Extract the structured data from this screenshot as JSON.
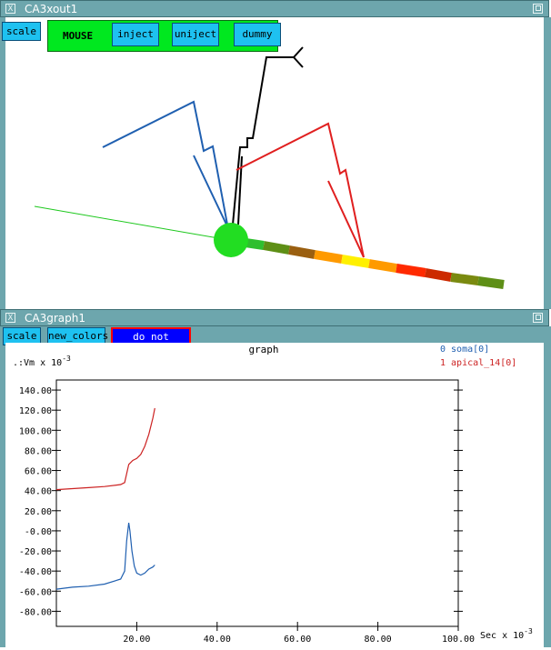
{
  "window1": {
    "title": "CA3xout1",
    "scale_label": "scale",
    "panel_label": "MOUSE",
    "inject_label": "inject",
    "uniject_label": "uniject",
    "dummy_label": "dummy",
    "colors": {
      "titlebar": "#6da6ad",
      "button": "#1ec1f0",
      "panel": "#00e81f"
    }
  },
  "window2": {
    "title": "CA3graph1",
    "scale_label": "scale",
    "new_colors_label": "new_colors",
    "overlay_label": "do not overlay",
    "colors": {
      "overlay_bg": "#0000ff",
      "overlay_border": "#ff0000"
    }
  },
  "graph": {
    "title": "graph",
    "ylabel": ".:Vm x 10",
    "yexp": "-3",
    "xlabel": "Sec x 10",
    "xexp": "-3",
    "legend": [
      {
        "label": "0 soma[0]",
        "color": "#1f5fb0"
      },
      {
        "label": "1 apical_14[0]",
        "color": "#cc2222"
      }
    ]
  },
  "chart_data": {
    "type": "line",
    "title": "graph",
    "xlabel": "Sec x 10^-3",
    "ylabel": "Vm x 10^-3",
    "xlim": [
      0,
      100
    ],
    "ylim": [
      -95,
      150
    ],
    "xticks": [
      "20.00",
      "40.00",
      "60.00",
      "80.00",
      "100.00"
    ],
    "yticks": [
      "140.00",
      "120.00",
      "100.00",
      "80.00",
      "60.00",
      "40.00",
      "20.00",
      "-0.00",
      "-20.00",
      "-40.00",
      "-60.00",
      "-80.00"
    ],
    "ytick_values": [
      140,
      120,
      100,
      80,
      60,
      40,
      20,
      0,
      -20,
      -40,
      -60,
      -80
    ],
    "xtick_values": [
      20,
      40,
      60,
      80,
      100
    ],
    "grid": false,
    "series": [
      {
        "name": "0 soma[0]",
        "color": "#1f5fb0",
        "x": [
          0,
          4,
          8,
          12,
          16,
          17,
          17.5,
          18,
          18.3,
          18.8,
          19.4,
          20,
          21,
          22,
          23,
          24,
          24.5
        ],
        "y": [
          -58,
          -56,
          -55,
          -53,
          -48,
          -40,
          -10,
          8,
          0,
          -20,
          -35,
          -42,
          -44,
          -42,
          -38,
          -36,
          -34
        ]
      },
      {
        "name": "1 apical_14[0]",
        "color": "#cc2222",
        "x": [
          0,
          4,
          8,
          12,
          16,
          17,
          18,
          19,
          20,
          21,
          22,
          23,
          24,
          24.5
        ],
        "y": [
          41,
          42,
          43,
          44,
          46,
          48,
          66,
          70,
          72,
          76,
          84,
          96,
          112,
          122
        ]
      }
    ]
  }
}
